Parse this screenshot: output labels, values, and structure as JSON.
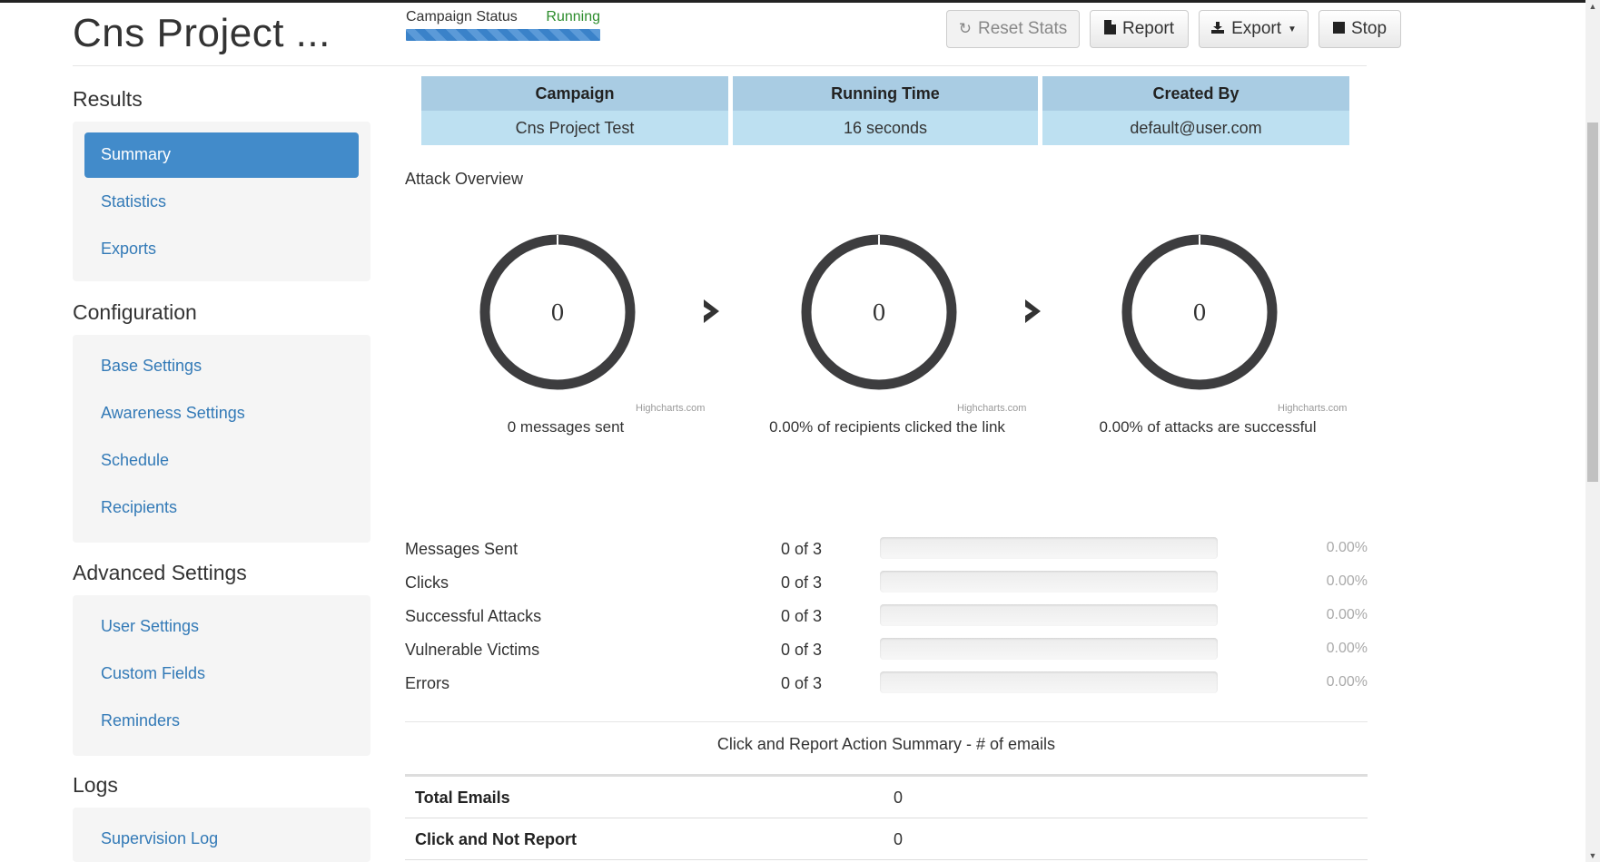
{
  "page": {
    "title": "Cns Project ..."
  },
  "status": {
    "label": "Campaign Status",
    "value": "Running"
  },
  "toolbar": {
    "reset_label": "Reset Stats",
    "report_label": "Report",
    "export_label": "Export",
    "stop_label": "Stop"
  },
  "sidebar": {
    "sections": [
      {
        "heading": "Results",
        "items": [
          "Summary",
          "Statistics",
          "Exports"
        ],
        "active": "Summary"
      },
      {
        "heading": "Configuration",
        "items": [
          "Base Settings",
          "Awareness Settings",
          "Schedule",
          "Recipients"
        ]
      },
      {
        "heading": "Advanced Settings",
        "items": [
          "User Settings",
          "Custom Fields",
          "Reminders"
        ]
      },
      {
        "heading": "Logs",
        "items": [
          "Supervision Log"
        ]
      }
    ]
  },
  "info": {
    "headers": [
      "Campaign",
      "Running Time",
      "Created By"
    ],
    "values": [
      "Cns Project Test",
      "16 seconds",
      "default@user.com"
    ]
  },
  "overview": {
    "label": "Attack Overview",
    "donuts": [
      {
        "value": "0",
        "caption": "0 messages sent",
        "credit": "Highcharts.com"
      },
      {
        "value": "0",
        "caption": "0.00% of recipients clicked the link",
        "credit": "Highcharts.com"
      },
      {
        "value": "0",
        "caption": "0.00% of attacks are successful",
        "credit": "Highcharts.com"
      }
    ]
  },
  "progress": [
    {
      "label": "Messages Sent",
      "count": "0 of 3",
      "percent": "0.00%",
      "fraction": 0
    },
    {
      "label": "Clicks",
      "count": "0 of 3",
      "percent": "0.00%",
      "fraction": 0
    },
    {
      "label": "Successful Attacks",
      "count": "0 of 3",
      "percent": "0.00%",
      "fraction": 0
    },
    {
      "label": "Vulnerable Victims",
      "count": "0 of 3",
      "percent": "0.00%",
      "fraction": 0
    },
    {
      "label": "Errors",
      "count": "0 of 3",
      "percent": "0.00%",
      "fraction": 0
    }
  ],
  "action_summary": {
    "title": "Click and Report Action Summary - # of emails",
    "rows": [
      {
        "key": "Total Emails",
        "value": "0"
      },
      {
        "key": "Click and Not Report",
        "value": "0"
      }
    ]
  },
  "icons": {
    "reset": "refresh-icon",
    "report": "file-icon",
    "export": "export-icon",
    "stop": "stop-icon",
    "arrow": "chevron-right-icon"
  },
  "colors": {
    "accent": "#428bca",
    "link": "#337ab7",
    "running": "#2c8c2c",
    "donut_ring": "#3d3d3f"
  }
}
